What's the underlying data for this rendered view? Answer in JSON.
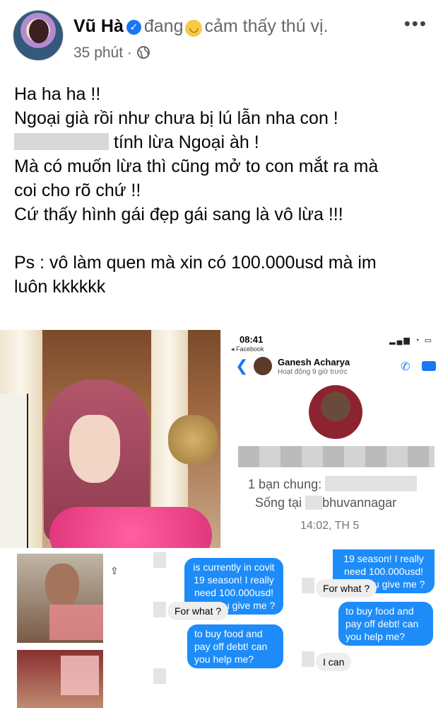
{
  "post": {
    "author": "Vũ Hà",
    "verified_icon": "verified-check-icon",
    "feeling_prefix": "đang",
    "feeling_emoji": "slightly-smiling-face-icon",
    "feeling_text": "cảm thấy thú vị.",
    "time": "35 phút",
    "separator": "·",
    "privacy_icon": "globe-icon",
    "more_label": "•••"
  },
  "body": {
    "line1": "Ha ha ha !!",
    "line2": "Ngoại già rồi như chưa bị lú lẫn nha con !",
    "line3_after_blur": "tính lừa Ngoại àh !",
    "line4": "Mà có muốn lừa thì cũng mở to con mắt ra mà",
    "line5": "coi cho rõ chứ !!",
    "line6": "Cứ thấy hình gái đẹp gái sang là vô lừa !!!",
    "line7": "Ps : vô làm quen mà xin có 100.000usd  mà im",
    "line8": "luôn kkkkkk"
  },
  "chat_screen": {
    "status_time": "08:41",
    "status_back": "◂ Facebook",
    "status_icons": "▂▄▆ ◔ ▭",
    "contact_name": "Ganesh Acharya",
    "contact_status": "Hoạt động 9 giờ trước",
    "mutual_label": "1 bạn chung:",
    "lives_prefix": "Sống tại",
    "lives_place": "bhuvannagar",
    "timestamp": "14:02, TH 5"
  },
  "chat_mid": {
    "msg1": "is currently in covit 19 season!  I really need 100.000usd! Can you give me ?",
    "reply1": "For what ?",
    "msg2": "to buy food and pay off debt!  can you help me?"
  },
  "chat_right": {
    "msg1": "19 season!  I really need 100.000usd! Can you give me ?",
    "reply1": "For what ?",
    "msg2": "to buy food and pay off debt!  can you help me?",
    "reply2": "I can"
  },
  "icons": {
    "share": "⇪",
    "back": "❮",
    "phone": "✆"
  }
}
